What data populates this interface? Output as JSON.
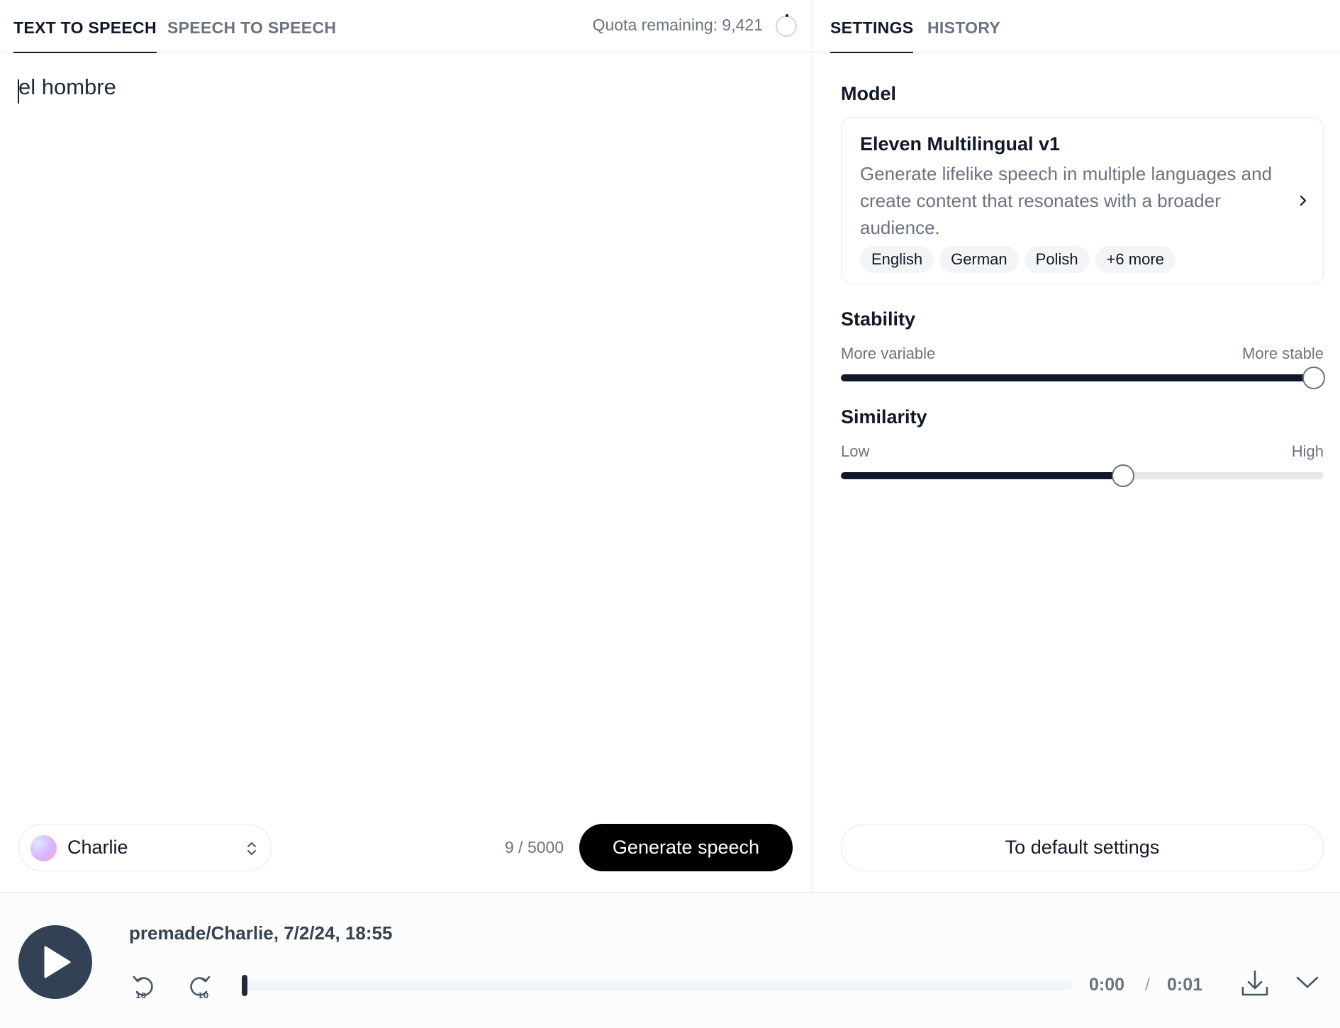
{
  "left_tabs": {
    "text_to_speech": "TEXT TO SPEECH",
    "speech_to_speech": "SPEECH TO SPEECH",
    "active": "text_to_speech"
  },
  "quota": {
    "label": "Quota remaining: 9,421"
  },
  "editor": {
    "text": "el hombre"
  },
  "voice": {
    "name": "Charlie"
  },
  "char_count": "9 / 5000",
  "generate_label": "Generate speech",
  "right_tabs": {
    "settings": "SETTINGS",
    "history": "HISTORY",
    "active": "settings"
  },
  "model": {
    "section_label": "Model",
    "name": "Eleven Multilingual v1",
    "description": "Generate lifelike speech in multiple languages and create content that resonates with a broader audience.",
    "languages": [
      "English",
      "German",
      "Polish"
    ],
    "more": "+6 more"
  },
  "stability": {
    "label": "Stability",
    "min_label": "More variable",
    "max_label": "More stable",
    "value": 0.98
  },
  "similarity": {
    "label": "Similarity",
    "min_label": "Low",
    "max_label": "High",
    "value": 0.585
  },
  "default_label": "To default settings",
  "player": {
    "title": "premade/Charlie, 7/2/24, 18:55",
    "current_time": "0:00",
    "separator": "/",
    "duration": "0:01",
    "progress": 0.0
  },
  "icons": {
    "play": "play-icon",
    "rewind": "rewind-10-icon",
    "forward": "forward-10-icon",
    "download": "download-icon",
    "collapse": "chevron-down-icon",
    "model_more": "chevron-right-icon",
    "voice_select": "chevron-up-down-icon"
  },
  "colors": {
    "accent": "#000000",
    "slider_fill": "#111827",
    "play_button": "#334155"
  }
}
